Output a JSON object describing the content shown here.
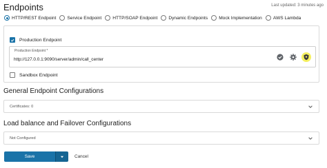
{
  "header": {
    "title": "Endpoints",
    "last_updated": "Last updated: 3 minutes ago"
  },
  "endpoint_types": [
    {
      "label": "HTTP/REST Endpoint",
      "selected": true
    },
    {
      "label": "Service Endpoint",
      "selected": false
    },
    {
      "label": "HTTP/SOAP Endpoint",
      "selected": false
    },
    {
      "label": "Dynamic Endpoints",
      "selected": false
    },
    {
      "label": "Mock Implementation",
      "selected": false
    },
    {
      "label": "AWS Lambda",
      "selected": false
    }
  ],
  "production": {
    "checkbox_label": "Production Endpoint",
    "checked": true,
    "field_label": "Production Endpoint *",
    "value": "http://127.0.0.1:9090/server/admin/call_center",
    "icons": [
      "check-circle-icon",
      "gear-icon",
      "shield-icon"
    ]
  },
  "sandbox": {
    "checkbox_label": "Sandbox Endpoint",
    "checked": false
  },
  "general": {
    "title": "General Endpoint Configurations",
    "certificates": "Certificates: 0"
  },
  "loadbalance": {
    "title": "Load balance and Failover Configurations",
    "value": "Not Configured"
  },
  "actions": {
    "save": "Save",
    "cancel": "Cancel"
  },
  "colors": {
    "accent": "#1a73a8",
    "highlight": "#f5f060"
  }
}
